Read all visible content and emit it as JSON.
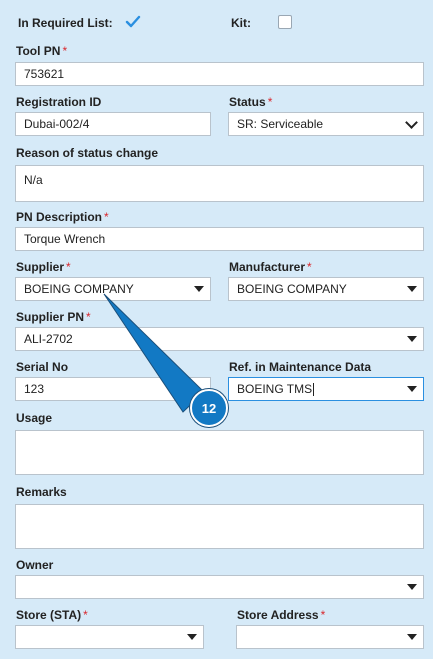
{
  "required_list": {
    "label": "In Required List:",
    "checked": true
  },
  "kit": {
    "label": "Kit:",
    "checked": false
  },
  "required_marker": "*",
  "tool_pn": {
    "label": "Tool PN",
    "value": "753621"
  },
  "registration_id": {
    "label": "Registration ID",
    "value": "Dubai-002/4"
  },
  "status": {
    "label": "Status",
    "value": "SR: Serviceable"
  },
  "reason": {
    "label": "Reason of status change",
    "value": "N/a"
  },
  "pn_description": {
    "label": "PN Description",
    "value": "Torque Wrench"
  },
  "supplier": {
    "label": "Supplier",
    "value": "BOEING COMPANY"
  },
  "manufacturer": {
    "label": "Manufacturer",
    "value": "BOEING COMPANY"
  },
  "supplier_pn": {
    "label": "Supplier PN",
    "value": "ALI-2702"
  },
  "serial_no": {
    "label": "Serial No",
    "value": "123"
  },
  "ref_maintenance": {
    "label": "Ref. in Maintenance Data",
    "value": "BOEING TMS"
  },
  "usage": {
    "label": "Usage",
    "value": ""
  },
  "remarks": {
    "label": "Remarks",
    "value": ""
  },
  "owner": {
    "label": "Owner",
    "value": ""
  },
  "store_sta": {
    "label": "Store (STA)",
    "value": ""
  },
  "store_address": {
    "label": "Store Address",
    "value": ""
  },
  "callout": {
    "number": "12"
  },
  "colors": {
    "background": "#d6eaf8",
    "required": "#d9262c",
    "callout": "#1279c4",
    "check": "#2a8fe0"
  }
}
